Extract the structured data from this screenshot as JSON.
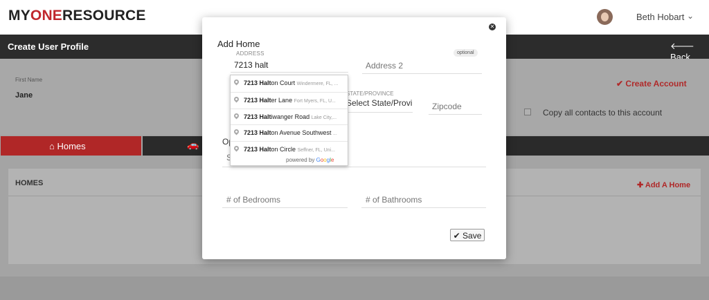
{
  "header": {
    "logo": {
      "prefix": "MY",
      "accent": "ONE",
      "suffix": "RESOURCE"
    },
    "user_name": "Beth Hobart",
    "user_chevron": "⌄"
  },
  "titlebar": {
    "title": "Create User Profile",
    "back_label": "Back",
    "back_icon": "arrow-left-icon"
  },
  "profile": {
    "first_name_label": "First Name",
    "first_name_value": "Jane",
    "create_account_label": "Create Account",
    "copy_contacts_label": "Copy all contacts to this account"
  },
  "tabs": [
    {
      "label": "Homes",
      "icon": "home-icon"
    },
    {
      "label": "",
      "icon": "car-icon"
    }
  ],
  "homes_panel": {
    "title": "HOMES",
    "add_label": "Add A Home"
  },
  "modal": {
    "title": "Add Home",
    "address_label": "ADDRESS",
    "optional_badge": "optional",
    "address_value": "7213 halt",
    "address2_placeholder": "Address 2",
    "state_label": "STATE/PROVINCE",
    "state_value": "Select State/Province",
    "zip_placeholder": "Zipcode",
    "partial_label": "Op",
    "partial_input": "S",
    "bedrooms_placeholder": "# of Bedrooms",
    "bathrooms_placeholder": "# of Bathrooms",
    "save_label": "Save",
    "close_icon": "close-icon"
  },
  "autocomplete": {
    "items": [
      {
        "match": "7213 ",
        "bold_rest": "Halt",
        "rest": "on Court",
        "secondary": "Windermere, FL, ..."
      },
      {
        "match": "7213 ",
        "bold_rest": "Halt",
        "rest": "er Lane",
        "secondary": "Fort Myers, FL, U..."
      },
      {
        "match": "7213 ",
        "bold_rest": "Halt",
        "rest": "iwanger Road",
        "secondary": "Lake City,..."
      },
      {
        "match": "7213 ",
        "bold_rest": "Halt",
        "rest": "on Avenue Southwest",
        "secondary": "..."
      },
      {
        "match": "7213 ",
        "bold_rest": "Halt",
        "rest": "on Circle",
        "secondary": "Seffner, FL, Uni..."
      }
    ],
    "powered_by": "powered by",
    "google": [
      "G",
      "o",
      "o",
      "g",
      "l",
      "e"
    ]
  },
  "colors": {
    "accent_red": "#b02727",
    "dark_bar": "#2c2c2c"
  }
}
